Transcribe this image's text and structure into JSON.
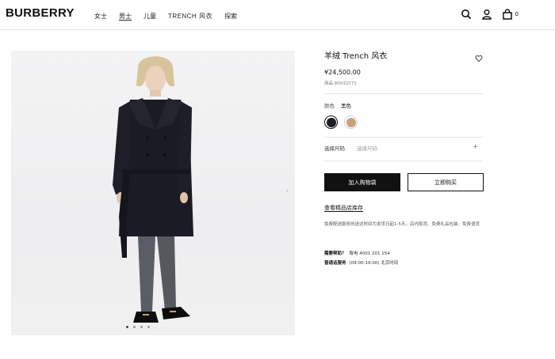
{
  "header": {
    "logo": "BURBERRY",
    "nav": [
      "女士",
      "男士",
      "儿童",
      "TRENCH 风衣",
      "探索"
    ],
    "active_nav": "男士",
    "icons": [
      "search-icon",
      "account-icon",
      "shopping-bag-icon"
    ],
    "bag_count": "0"
  },
  "product": {
    "title": "羊绒 Trench 风衣",
    "price": "¥24,500.00",
    "sku": "商品 80032271",
    "color_label": "颜色",
    "color_value": "黑色",
    "swatches": [
      {
        "name": "黑色",
        "color": "#1c1d22",
        "selected": true
      },
      {
        "name": "蜂蜜色",
        "color": "#c9a27c",
        "selected": false
      }
    ],
    "size_label": "选择尺码",
    "size_placeholder": "选择尺码",
    "add_to_bag": "加入购物袋",
    "buy_now": "立即购买",
    "store_link": "查看精品店库存",
    "shipping_info": "免费配送服务的送达时间为发货日起1-5天。店内取货、免费礼品包装、免费退货",
    "help_label": "需要帮助？",
    "help_phone": "致电 4001 201 154",
    "service_label": "普通话服务",
    "service_hours": "(09:00-19:00) 北京时间"
  },
  "gallery": {
    "slide_count": 4,
    "current_slide": 1
  },
  "colors": {
    "accent": "#111111",
    "coat": "#1a1b24",
    "background": "#f0f0f1"
  }
}
